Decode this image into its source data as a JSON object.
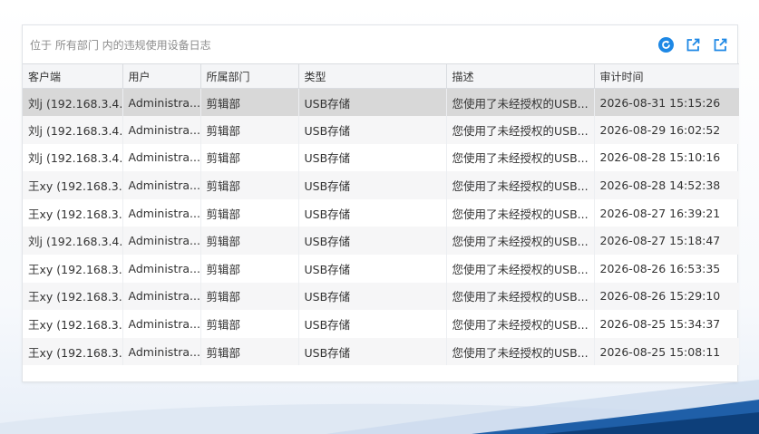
{
  "panel": {
    "title": "位于 所有部门 内的违规使用设备日志"
  },
  "toolbar": {
    "refresh_icon": "refresh-icon",
    "export_icon": "export-icon",
    "export_all_icon": "export-all-icon",
    "accent": "#1e88e5"
  },
  "table": {
    "headers": [
      "客户端",
      "用户",
      "所属部门",
      "类型",
      "描述",
      "审计时间"
    ],
    "rows": [
      {
        "client": "刘j (192.168.3.4...",
        "user": "Administra...",
        "dept": "剪辑部",
        "type": "USB存储",
        "desc": "您使用了未经授权的USB...",
        "time": "2026-08-31 15:15:26"
      },
      {
        "client": "刘j (192.168.3.4...",
        "user": "Administra...",
        "dept": "剪辑部",
        "type": "USB存储",
        "desc": "您使用了未经授权的USB...",
        "time": "2026-08-29 16:02:52"
      },
      {
        "client": "刘j (192.168.3.4...",
        "user": "Administra...",
        "dept": "剪辑部",
        "type": "USB存储",
        "desc": "您使用了未经授权的USB...",
        "time": "2026-08-28 15:10:16"
      },
      {
        "client": "王xy (192.168.3...",
        "user": "Administra...",
        "dept": "剪辑部",
        "type": "USB存储",
        "desc": "您使用了未经授权的USB...",
        "time": "2026-08-28 14:52:38"
      },
      {
        "client": "王xy (192.168.3...",
        "user": "Administra...",
        "dept": "剪辑部",
        "type": "USB存储",
        "desc": "您使用了未经授权的USB...",
        "time": "2026-08-27 16:39:21"
      },
      {
        "client": "刘j (192.168.3.4...",
        "user": "Administra...",
        "dept": "剪辑部",
        "type": "USB存储",
        "desc": "您使用了未经授权的USB...",
        "time": "2026-08-27 15:18:47"
      },
      {
        "client": "王xy (192.168.3...",
        "user": "Administra...",
        "dept": "剪辑部",
        "type": "USB存储",
        "desc": "您使用了未经授权的USB...",
        "time": "2026-08-26 16:53:35"
      },
      {
        "client": "王xy (192.168.3...",
        "user": "Administra...",
        "dept": "剪辑部",
        "type": "USB存储",
        "desc": "您使用了未经授权的USB...",
        "time": "2026-08-26 15:29:10"
      },
      {
        "client": "王xy (192.168.3...",
        "user": "Administra...",
        "dept": "剪辑部",
        "type": "USB存储",
        "desc": "您使用了未经授权的USB...",
        "time": "2026-08-25 15:34:37"
      },
      {
        "client": "王xy (192.168.3...",
        "user": "Administra...",
        "dept": "剪辑部",
        "type": "USB存储",
        "desc": "您使用了未经授权的USB...",
        "time": "2026-08-25 15:08:11"
      }
    ]
  }
}
